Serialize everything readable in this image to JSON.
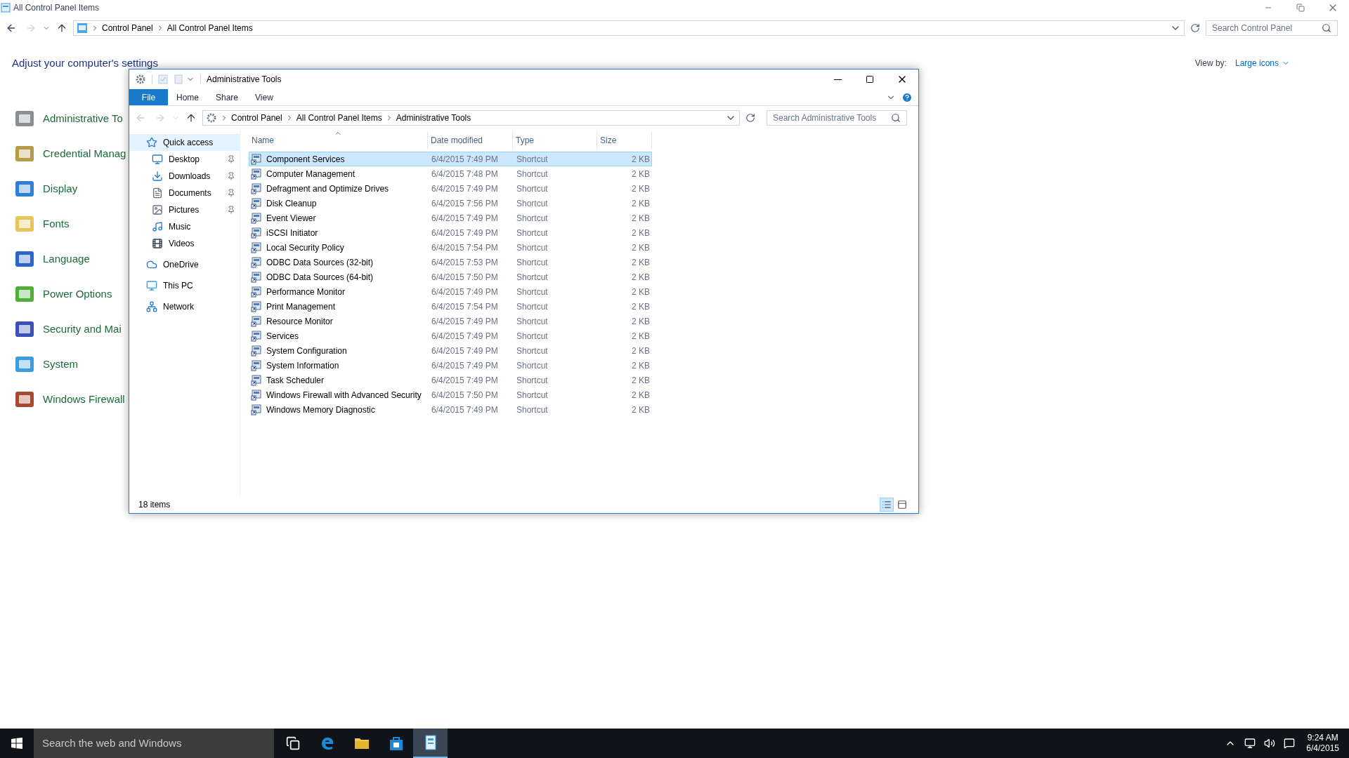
{
  "background_window": {
    "title": "All Control Panel Items",
    "breadcrumbs": [
      "Control Panel",
      "All Control Panel Items"
    ],
    "search": {
      "placeholder": "Search Control Panel"
    },
    "heading": "Adjust your computer's settings",
    "view_by": {
      "label": "View by:",
      "value": "Large icons"
    },
    "items": [
      {
        "label": "Administrative To",
        "color": "#8a8f96"
      },
      {
        "label": "Credential Manag",
        "color": "#b59a4a"
      },
      {
        "label": "Display",
        "color": "#2f7fd6"
      },
      {
        "label": "Fonts",
        "color": "#e8c45a"
      },
      {
        "label": "Language",
        "color": "#2a66c9"
      },
      {
        "label": "Power Options",
        "color": "#4fae3a"
      },
      {
        "label": "Security and Mai",
        "color": "#3b4fb8"
      },
      {
        "label": "System",
        "color": "#3d9be0"
      },
      {
        "label": "Windows Firewall",
        "color": "#a84a32"
      }
    ]
  },
  "explorer": {
    "title": "Administrative Tools",
    "ribbon_tabs": [
      {
        "label": "File",
        "kind": "file"
      },
      {
        "label": "Home",
        "kind": "tab"
      },
      {
        "label": "Share",
        "kind": "tab"
      },
      {
        "label": "View",
        "kind": "tab"
      }
    ],
    "breadcrumbs": [
      "Control Panel",
      "All Control Panel Items",
      "Administrative Tools"
    ],
    "search": {
      "placeholder": "Search Administrative Tools"
    },
    "nav": [
      {
        "label": "Quick access",
        "selected": true,
        "children": [
          {
            "label": "Desktop",
            "pinned": true,
            "selected": false
          },
          {
            "label": "Downloads",
            "pinned": true,
            "selected": false
          },
          {
            "label": "Documents",
            "pinned": true,
            "selected": false
          },
          {
            "label": "Pictures",
            "pinned": true,
            "selected": false
          },
          {
            "label": "Music",
            "pinned": false,
            "selected": false
          },
          {
            "label": "Videos",
            "pinned": false,
            "selected": false
          }
        ]
      },
      {
        "label": "OneDrive",
        "selected": false
      },
      {
        "label": "This PC",
        "selected": false
      },
      {
        "label": "Network",
        "selected": false
      }
    ],
    "columns": [
      {
        "label": "Name",
        "sorted": true
      },
      {
        "label": "Date modified",
        "sorted": false
      },
      {
        "label": "Type",
        "sorted": false
      },
      {
        "label": "Size",
        "sorted": false
      }
    ],
    "rows": [
      {
        "name": "Component Services",
        "date": "6/4/2015 7:49 PM",
        "type": "Shortcut",
        "size": "2 KB",
        "selected": true
      },
      {
        "name": "Computer Management",
        "date": "6/4/2015 7:48 PM",
        "type": "Shortcut",
        "size": "2 KB",
        "selected": false
      },
      {
        "name": "Defragment and Optimize Drives",
        "date": "6/4/2015 7:49 PM",
        "type": "Shortcut",
        "size": "2 KB",
        "selected": false
      },
      {
        "name": "Disk Cleanup",
        "date": "6/4/2015 7:56 PM",
        "type": "Shortcut",
        "size": "2 KB",
        "selected": false
      },
      {
        "name": "Event Viewer",
        "date": "6/4/2015 7:49 PM",
        "type": "Shortcut",
        "size": "2 KB",
        "selected": false
      },
      {
        "name": "iSCSI Initiator",
        "date": "6/4/2015 7:49 PM",
        "type": "Shortcut",
        "size": "2 KB",
        "selected": false
      },
      {
        "name": "Local Security Policy",
        "date": "6/4/2015 7:54 PM",
        "type": "Shortcut",
        "size": "2 KB",
        "selected": false
      },
      {
        "name": "ODBC Data Sources (32-bit)",
        "date": "6/4/2015 7:53 PM",
        "type": "Shortcut",
        "size": "2 KB",
        "selected": false
      },
      {
        "name": "ODBC Data Sources (64-bit)",
        "date": "6/4/2015 7:50 PM",
        "type": "Shortcut",
        "size": "2 KB",
        "selected": false
      },
      {
        "name": "Performance Monitor",
        "date": "6/4/2015 7:49 PM",
        "type": "Shortcut",
        "size": "2 KB",
        "selected": false
      },
      {
        "name": "Print Management",
        "date": "6/4/2015 7:54 PM",
        "type": "Shortcut",
        "size": "2 KB",
        "selected": false
      },
      {
        "name": "Resource Monitor",
        "date": "6/4/2015 7:49 PM",
        "type": "Shortcut",
        "size": "2 KB",
        "selected": false
      },
      {
        "name": "Services",
        "date": "6/4/2015 7:49 PM",
        "type": "Shortcut",
        "size": "2 KB",
        "selected": false
      },
      {
        "name": "System Configuration",
        "date": "6/4/2015 7:49 PM",
        "type": "Shortcut",
        "size": "2 KB",
        "selected": false
      },
      {
        "name": "System Information",
        "date": "6/4/2015 7:49 PM",
        "type": "Shortcut",
        "size": "2 KB",
        "selected": false
      },
      {
        "name": "Task Scheduler",
        "date": "6/4/2015 7:49 PM",
        "type": "Shortcut",
        "size": "2 KB",
        "selected": false
      },
      {
        "name": "Windows Firewall with Advanced Security",
        "date": "6/4/2015 7:50 PM",
        "type": "Shortcut",
        "size": "2 KB",
        "selected": false
      },
      {
        "name": "Windows Memory Diagnostic",
        "date": "6/4/2015 7:49 PM",
        "type": "Shortcut",
        "size": "2 KB",
        "selected": false
      }
    ],
    "status": "18 items",
    "view_buttons": [
      {
        "kind": "details",
        "selected": true
      },
      {
        "kind": "preview",
        "selected": false
      }
    ]
  },
  "taskbar": {
    "search": {
      "placeholder": "Search the web and Windows"
    },
    "apps": [
      {
        "kind": "taskview",
        "active": false
      },
      {
        "kind": "edge",
        "active": false
      },
      {
        "kind": "explorer",
        "active": false
      },
      {
        "kind": "store",
        "active": false
      },
      {
        "kind": "controlpanel",
        "active": true
      }
    ],
    "time": "9:24 AM",
    "date": "6/4/2015"
  }
}
